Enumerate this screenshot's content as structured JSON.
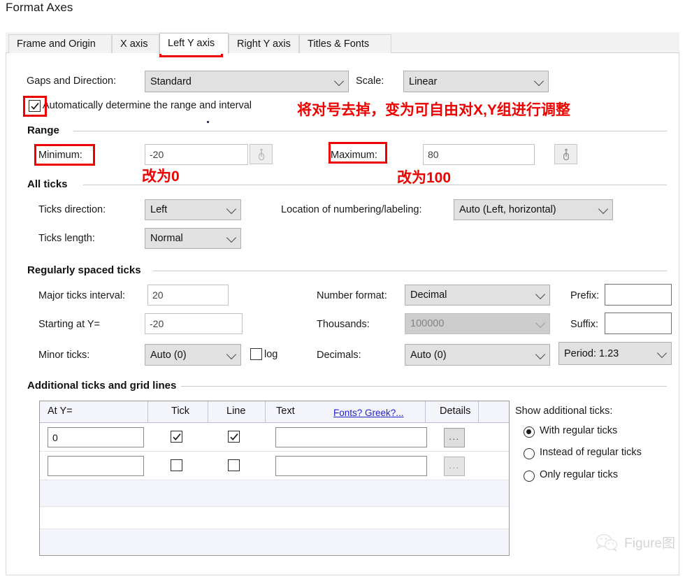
{
  "window": {
    "title": "Format Axes"
  },
  "tabs": [
    {
      "label": "Frame and Origin",
      "active": false
    },
    {
      "label": "X axis",
      "active": false
    },
    {
      "label": "Left Y axis",
      "active": true
    },
    {
      "label": "Right Y axis",
      "active": false
    },
    {
      "label": "Titles & Fonts",
      "active": false
    }
  ],
  "top": {
    "gaps_label": "Gaps and Direction:",
    "gaps_value": "Standard",
    "scale_label": "Scale:",
    "scale_value": "Linear",
    "auto_checkbox_label": "Automatically determine the range and interval",
    "auto_checkbox_checked": true
  },
  "range": {
    "group_title": "Range",
    "minimum_label": "Minimum:",
    "minimum_value": "-20",
    "maximum_label": "Maximum:",
    "maximum_value": "80"
  },
  "all_ticks": {
    "group_title": "All ticks",
    "direction_label": "Ticks direction:",
    "direction_value": "Left",
    "length_label": "Ticks length:",
    "length_value": "Normal",
    "location_label": "Location of numbering/labeling:",
    "location_value": "Auto (Left, horizontal)"
  },
  "regular_ticks": {
    "group_title": "Regularly spaced ticks",
    "major_label": "Major ticks interval:",
    "major_value": "20",
    "starting_label": "Starting at Y=",
    "starting_value": "-20",
    "minor_label": "Minor ticks:",
    "minor_value": "Auto (0)",
    "log_label": "log",
    "log_checked": false,
    "number_format_label": "Number format:",
    "number_format_value": "Decimal",
    "thousands_label": "Thousands:",
    "thousands_value": "100000",
    "decimals_label": "Decimals:",
    "decimals_value": "Auto (0)",
    "prefix_label": "Prefix:",
    "prefix_value": "",
    "suffix_label": "Suffix:",
    "suffix_value": "",
    "period_value": "Period: 1.23"
  },
  "additional": {
    "group_title": "Additional ticks and grid lines",
    "columns": [
      "At Y=",
      "Tick",
      "Line",
      "Text",
      "Details"
    ],
    "fonts_link": "Fonts? Greek?...",
    "rows": [
      {
        "at_y": "0",
        "tick": true,
        "line": true,
        "text": "",
        "details": "..."
      },
      {
        "at_y": "",
        "tick": false,
        "line": false,
        "text": "",
        "details": "..."
      }
    ],
    "show_label": "Show additional ticks:",
    "options": [
      {
        "label": "With regular ticks",
        "selected": true
      },
      {
        "label": "Instead of regular ticks",
        "selected": false
      },
      {
        "label": "Only regular ticks",
        "selected": false
      }
    ]
  },
  "annotations": {
    "color": "#ee0000",
    "note_auto": "将对号去掉，变为可自由对X,Y组进行调整",
    "note_min": "改为0",
    "note_max": "改为100"
  },
  "watermark": {
    "text": "Figure图",
    "icon": "wechat-icon"
  }
}
